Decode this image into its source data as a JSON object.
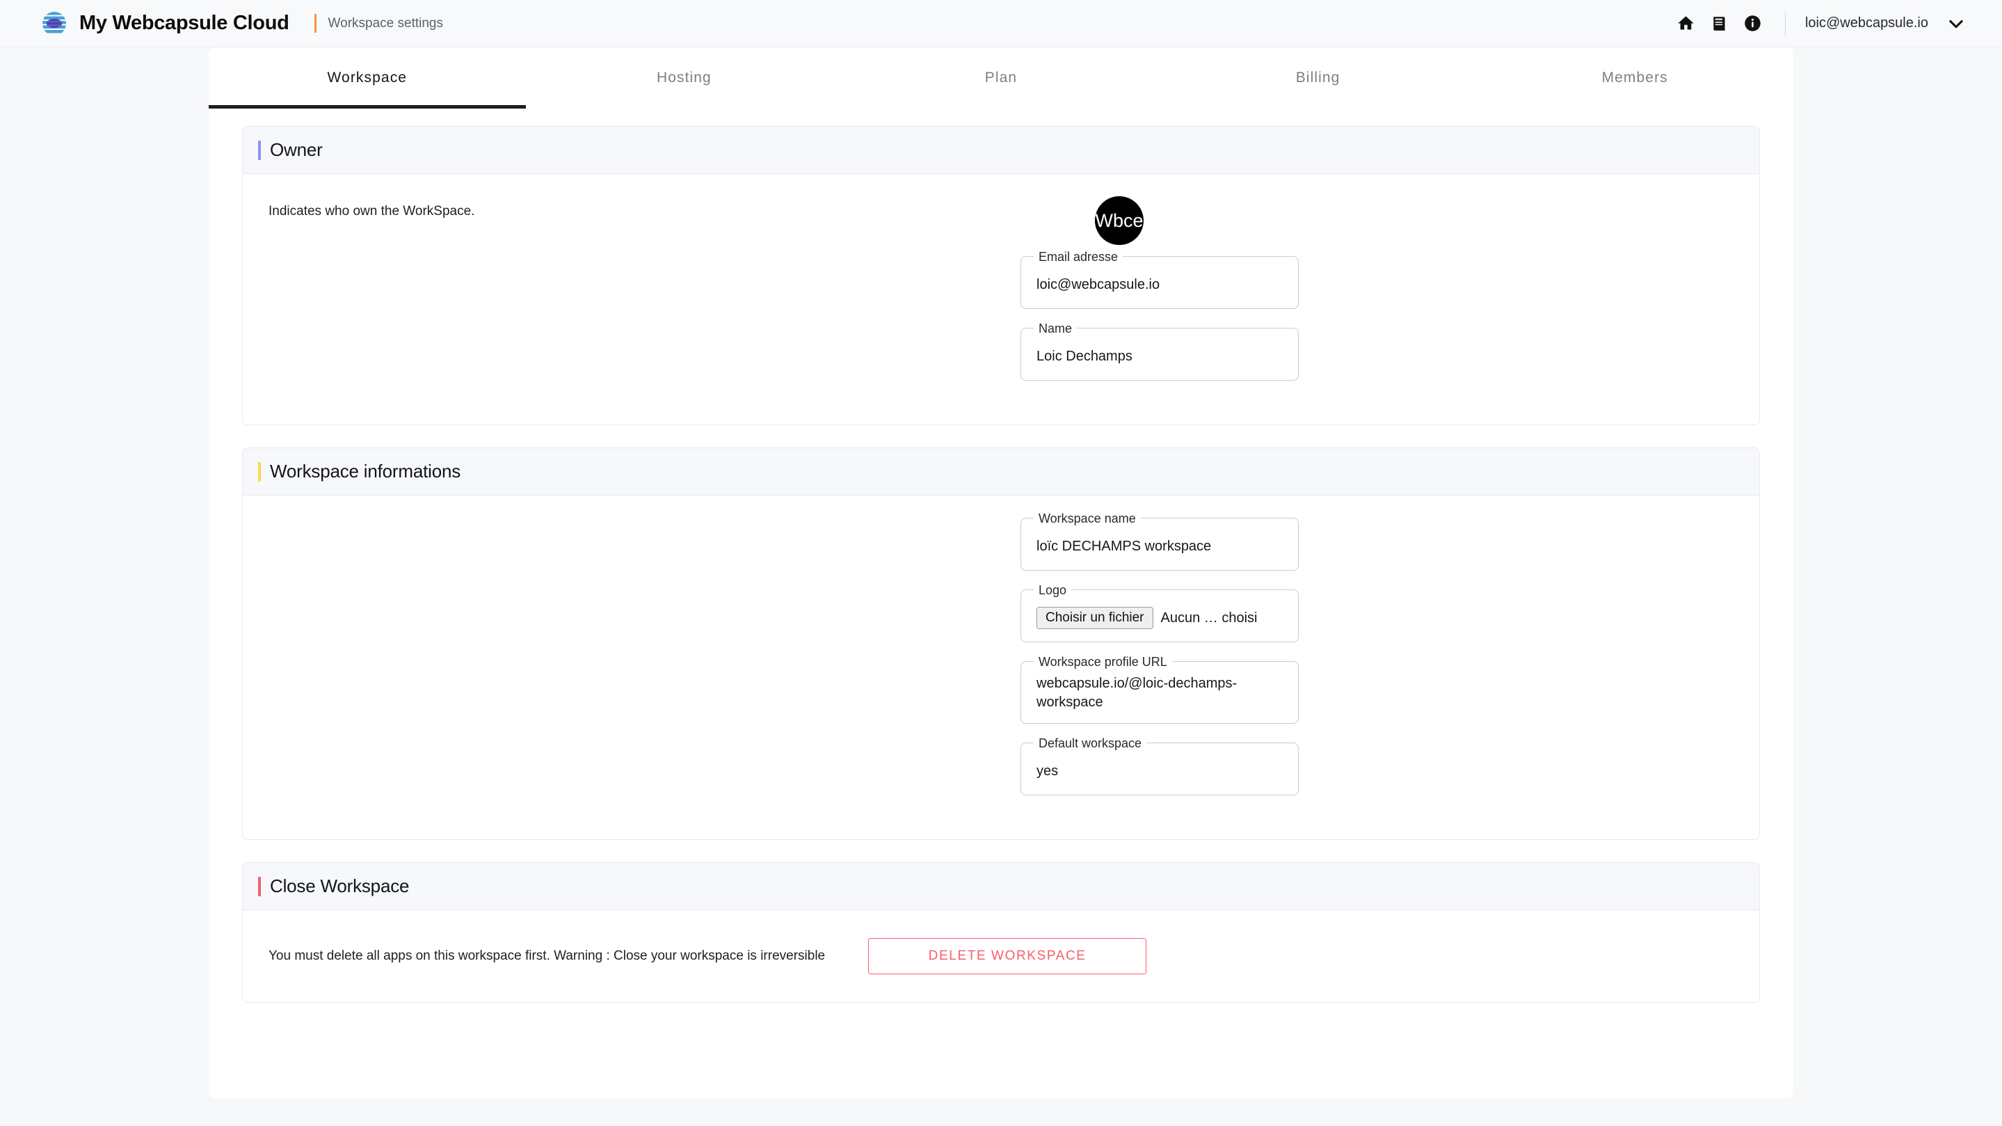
{
  "appbar": {
    "brand_title": "My Webcapsule Cloud",
    "breadcrumb": "Workspace settings",
    "icons": [
      "home-icon",
      "book-icon",
      "info-icon"
    ],
    "user_email": "loic@webcapsule.io",
    "chevron": "chevron-down-icon"
  },
  "tabs": [
    {
      "label": "Workspace",
      "active": true
    },
    {
      "label": "Hosting",
      "active": false
    },
    {
      "label": "Plan",
      "active": false
    },
    {
      "label": "Billing",
      "active": false
    },
    {
      "label": "Members",
      "active": false
    }
  ],
  "owner": {
    "title": "Owner",
    "accent": "#8d93f2",
    "description": "Indicates who own the WorkSpace.",
    "avatar_text": "Wbce",
    "fields": [
      {
        "label": "Email adresse",
        "value": "loic@webcapsule.io"
      },
      {
        "label": "Name",
        "value": "Loic Dechamps"
      }
    ]
  },
  "workspace_info": {
    "title": "Workspace informations",
    "accent": "#ffd84d",
    "name_field": {
      "label": "Workspace name",
      "value": "loïc DECHAMPS workspace"
    },
    "logo_field": {
      "label": "Logo",
      "button_label": "Choisir un fichier",
      "file_name": "Aucun … choisi"
    },
    "url_field": {
      "label": "Workspace profile URL",
      "value": "webcapsule.io/@loic-dechamps-workspace"
    },
    "default_field": {
      "label": "Default workspace",
      "value": "yes"
    }
  },
  "close_workspace": {
    "title": "Close Workspace",
    "accent": "#f4606c",
    "warning": "You must delete all apps on this workspace first. Warning : Close your workspace is irreversible",
    "delete_button": "DELETE WORKSPACE",
    "danger_color": "#f4606c"
  }
}
